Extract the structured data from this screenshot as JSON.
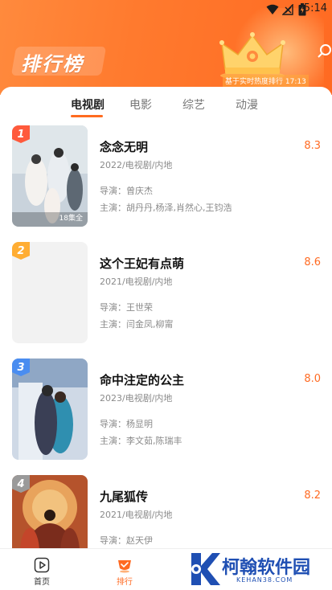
{
  "status_bar": {
    "time": "5:14"
  },
  "header": {
    "title": "排行榜",
    "update_note": "基于实时热度排行 17:13"
  },
  "tabs": [
    {
      "label": "电视剧",
      "active": true
    },
    {
      "label": "电影",
      "active": false
    },
    {
      "label": "综艺",
      "active": false
    },
    {
      "label": "动漫",
      "active": false
    }
  ],
  "items": [
    {
      "rank": "1",
      "title": "念念无明",
      "meta": "2022/电视剧/内地",
      "director": "导演：曾庆杰",
      "cast": "主演：胡丹丹,杨泽,肖然心,王钧浩",
      "score": "8.3",
      "episode": "18集全",
      "badge_color": "#ff5a3c"
    },
    {
      "rank": "2",
      "title": "这个王妃有点萌",
      "meta": "2021/电视剧/内地",
      "director": "导演：王世荣",
      "cast": "主演：闫金凤,柳甯",
      "score": "8.6",
      "episode": "",
      "badge_color": "#ffad33"
    },
    {
      "rank": "3",
      "title": "命中注定的公主",
      "meta": "2023/电视剧/内地",
      "director": "导演：杨显明",
      "cast": "主演：李文茹,陈瑞丰",
      "score": "8.0",
      "episode": "",
      "badge_color": "#4a8df0"
    },
    {
      "rank": "4",
      "title": "九尾狐传",
      "meta": "2021/电视剧/内地",
      "director": "导演：赵天伊",
      "cast": "",
      "score": "8.2",
      "episode": "",
      "badge_color": "#9a9a9a"
    }
  ],
  "bottom_nav": [
    {
      "label": "首页",
      "icon": "play-icon",
      "active": false
    },
    {
      "label": "排行",
      "icon": "ranking-icon",
      "active": true
    }
  ],
  "watermark": {
    "name": "柯翰软件园",
    "url": "KEHAN38.COM"
  },
  "colors": {
    "accent": "#ff6a22",
    "header_start": "#ff8a3d",
    "header_end": "#ff6a22"
  }
}
